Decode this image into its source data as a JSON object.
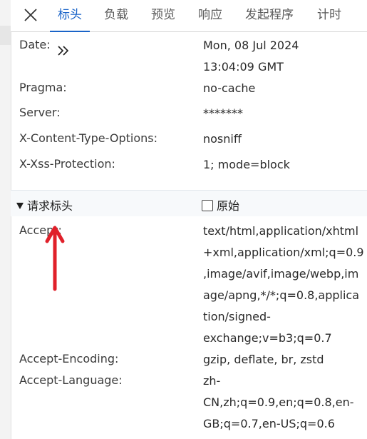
{
  "tabs": [
    {
      "label": "标头",
      "active": true
    },
    {
      "label": "负载",
      "active": false
    },
    {
      "label": "预览",
      "active": false
    },
    {
      "label": "响应",
      "active": false
    },
    {
      "label": "发起程序",
      "active": false
    },
    {
      "label": "计时",
      "active": false
    }
  ],
  "response_headers": [
    {
      "name": "Date:",
      "value_lines": [
        "Mon, 08 Jul 2024",
        "13:04:09 GMT"
      ]
    },
    {
      "name": "Pragma:",
      "value_lines": [
        "no-cache"
      ]
    },
    {
      "name": "Server:",
      "value_lines": [
        "*******"
      ]
    },
    {
      "name": "X-Content-Type-Options:",
      "value_lines": [
        "nosniff"
      ]
    },
    {
      "name": "X-Xss-Protection:",
      "value_lines": [
        "1; mode=block"
      ]
    }
  ],
  "request_section": {
    "title": "请求标头",
    "raw_label": "原始",
    "raw_checked": false
  },
  "request_headers": [
    {
      "name": "Accept:",
      "value_lines": [
        "text/html,application/xhtml",
        "+xml,application/xml;q=0.9",
        ",image/avif,image/webp,im",
        "age/apng,*/*;q=0.8,applica",
        "tion/signed-",
        "exchange;v=b3;q=0.7"
      ]
    },
    {
      "name": "Accept-Encoding:",
      "value_lines": [
        "gzip, deflate, br, zstd"
      ]
    },
    {
      "name": "Accept-Language:",
      "value_lines": [
        "zh-",
        "CN,zh;q=0.9,en;q=0.8,en-",
        "GB;q=0.7,en-US;q=0.6"
      ]
    }
  ],
  "colors": {
    "accent": "#1a64c8",
    "annotation_arrow": "#e0202a"
  },
  "icons": {
    "close": "close-icon",
    "expand": "double-chevron-right-icon",
    "collapse": "triangle-down-icon",
    "annotation": "red-arrow-annotation"
  }
}
